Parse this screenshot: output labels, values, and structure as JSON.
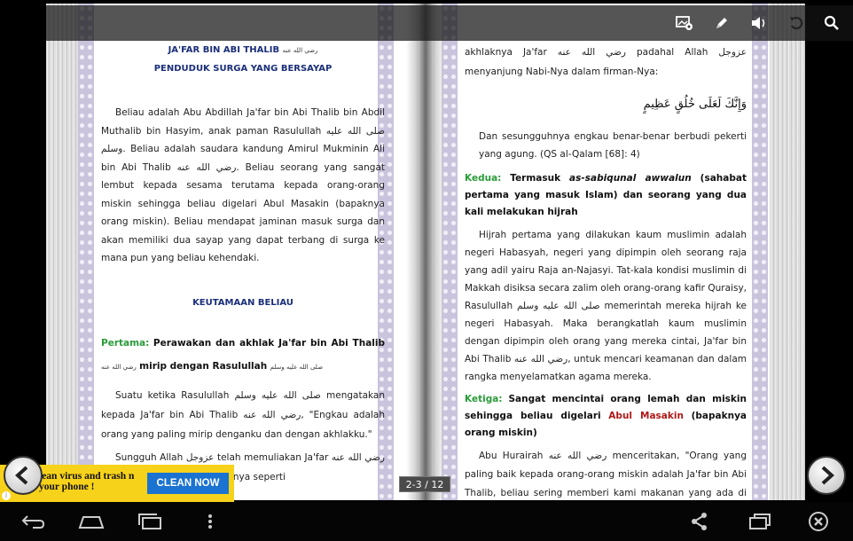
{
  "left_page": {
    "title": "JA'FAR BIN ABI THALIB",
    "title_honorific": "رضي الله عنه",
    "subtitle": "PENDUDUK SURGA YANG BERSAYAP",
    "intro": "Beliau adalah Abu Abdillah Ja'far bin Abi Thalib bin Abdil Muthalib bin Hasyim, anak paman Rasulullah صلى الله عليه وسلم. Beliau adalah saudara kandung Amirul Mukminin Ali bin Abi Thalib رضي الله عنه. Beliau seorang yang sangat lembut kepada sesama terutama kepada orang-orang miskin sehingga beliau digelari Abul Masakin (bapaknya orang miskin). Beliau mendapat jaminan masuk surga dan akan memiliki dua sayap yang dapat terbang di surga ke mana pun yang beliau kehendaki.",
    "section_title": "KEUTAMAAN BELIAU",
    "point1_label": "Pertama:",
    "point1_text": "Perawakan dan akhlak Ja'far bin Abi Thalib",
    "point1_honorific": "رضي الله عنه",
    "point1_text2": "mirip dengan Rasulullah",
    "point1_honorific2": "صلى الله عليه وسلم",
    "para2": "Suatu ketika Rasulullah صلى الله عليه وسلم mengatakan kepada Ja'far bin Abi Thalib رضي الله عنه, \"Engkau adalah orang yang paling mirip denganku dan dengan akhlakku.\"",
    "para3": "Sungguh Allah عزوجل telah memuliakan Ja'far رضي الله عنه karena menyamakan akhlaknya seperti"
  },
  "right_page": {
    "para1": "akhlaknya Ja'far رضي الله عنه padahal Allah عزوجل menyanjung Nabi-Nya dalam firman-Nya:",
    "verse": "وَإِنَّكَ لَعَلَى خُلُقٍ عَظِيمٍ",
    "translation": "Dan sesungguhnya engkau benar-benar berbudi pekerti yang agung. (QS al-Qalam [68]: 4)",
    "point2_label": "Kedua:",
    "point2_text_a": "Termasuk",
    "point2_italic": "as-sabiqunal awwalun",
    "point2_text_b": "(sahabat pertama yang masuk Islam) dan seorang yang dua kali melakukan hijrah",
    "para2": "Hijrah pertama yang dilakukan kaum muslimin adalah negeri Habasyah, negeri yang dipimpin oleh seorang raja yang adil yairu Raja an-Najasyi. Tat-kala kondisi muslimin di Makkah disiksa secara zalim oleh orang-orang kafir Quraisy, Rasulullah صلى الله عليه وسلم memerintah mereka hijrah ke negeri Habasyah. Maka berangkatlah kaum muslimin dengan dipimpin oleh orang yang mereka cintai, Ja'far bin Abi Thalib رضي الله عنه, untuk mencari keamanan dan dalam rangka menyelamatkan agama mereka.",
    "point3_label": "Ketiga:",
    "point3_text_a": "Sangat mencintai orang lemah dan miskin sehingga beliau digelari",
    "point3_red": "Abul Masakin",
    "point3_text_b": "(bapaknya orang miskin)",
    "para3": "Abu Hurairah رضي الله عنه menceritakan, \"Orang yang paling baik kepada orang-orang miskin adalah Ja'far bin Abi Thalib, beliau sering memberi kami makanan yang ada di dalam rumahnya,"
  },
  "toolbar": {
    "icons": [
      "image-settings-icon",
      "pen-icon",
      "volume-icon",
      "undo-icon",
      "search-icon"
    ]
  },
  "page_indicator": "2-3 / 12",
  "ad": {
    "text": "lean virus and trash n your phone !",
    "button": "CLEAN NOW",
    "info": "i"
  },
  "colors": {
    "title_blue": "#1b2f7a",
    "label_green": "#2a9c3a",
    "highlight_red": "#b01818",
    "ad_yellow": "#f7d21a",
    "ad_button": "#1b73d1"
  }
}
